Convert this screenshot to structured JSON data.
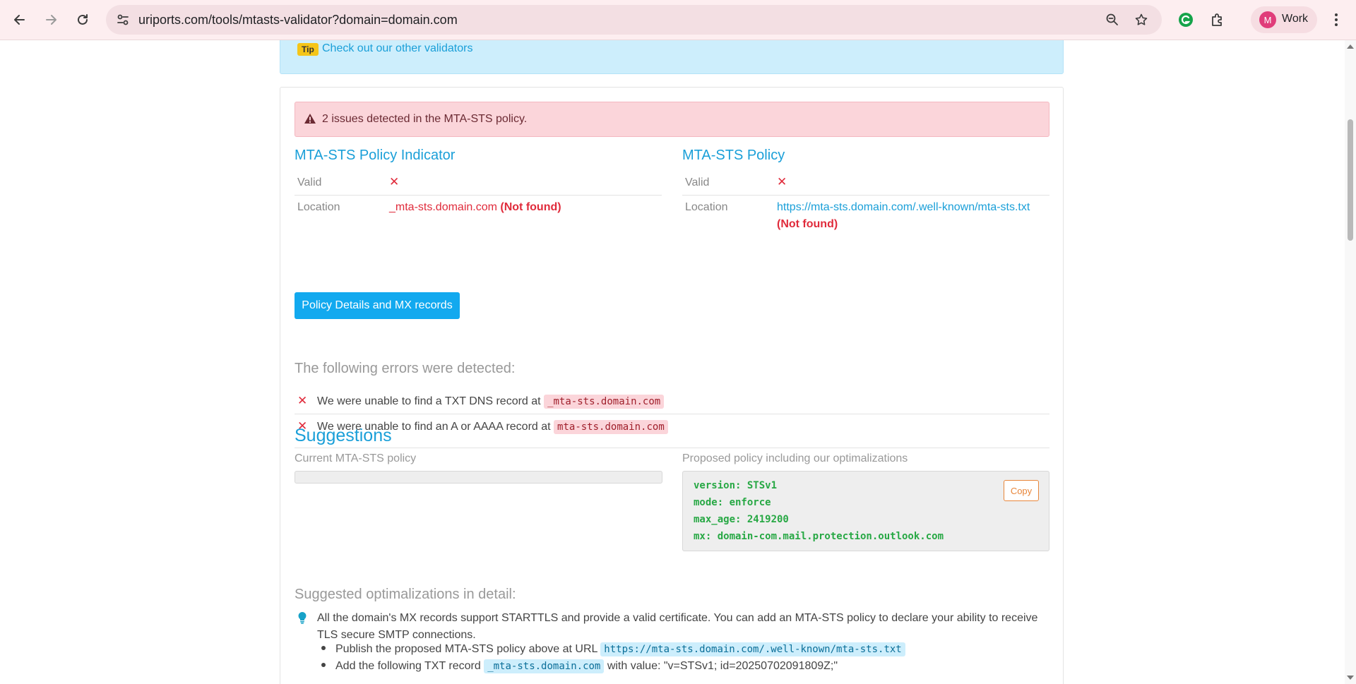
{
  "browser": {
    "url": "uriports.com/tools/mtasts-validator?domain=domain.com",
    "profile_initial": "M",
    "profile_label": "Work"
  },
  "tip": {
    "badge": "Tip",
    "link": "Check out our other validators"
  },
  "alert": {
    "text": "2 issues detected in the MTA-STS policy."
  },
  "indicator": {
    "title": "MTA-STS Policy Indicator",
    "valid_label": "Valid",
    "valid_value": "✕",
    "location_label": "Location",
    "location_value": "_mta-sts.domain.com",
    "location_status": "(Not found)"
  },
  "policy": {
    "title": "MTA-STS Policy",
    "valid_label": "Valid",
    "valid_value": "✕",
    "location_label": "Location",
    "location_value": "https://mta-sts.domain.com/.well-known/mta-sts.txt",
    "location_status": "(Not found)"
  },
  "details_button": "Policy Details and MX records",
  "errors": {
    "heading": "The following errors were detected:",
    "items": [
      {
        "text": "We were unable to find a TXT DNS record at",
        "code": "_mta-sts.domain.com"
      },
      {
        "text": "We were unable to find an A or AAAA record at",
        "code": "mta-sts.domain.com"
      }
    ]
  },
  "suggestions": {
    "heading": "Suggestions",
    "current_label": "Current MTA-STS policy",
    "proposed_label": "Proposed policy including our optimalizations",
    "proposed_lines": [
      "version: STSv1",
      "mode: enforce",
      "max_age: 2419200",
      "mx: domain-com.mail.protection.outlook.com"
    ],
    "copy": "Copy"
  },
  "optimalizations": {
    "heading": "Suggested optimalizations in detail:",
    "text": "All the domain's MX records support STARTTLS and provide a valid certificate. You can add an MTA-STS policy to declare your ability to receive TLS secure SMTP connections.",
    "bullet1_text": "Publish the proposed MTA-STS policy above at URL",
    "bullet1_code": "https://mta-sts.domain.com/.well-known/mta-sts.txt",
    "bullet2_text": "Add the following TXT record",
    "bullet2_code": "_mta-sts.domain.com",
    "bullet2_suffix": "with value: \"v=STSv1; id=20250702091809Z;\""
  }
}
